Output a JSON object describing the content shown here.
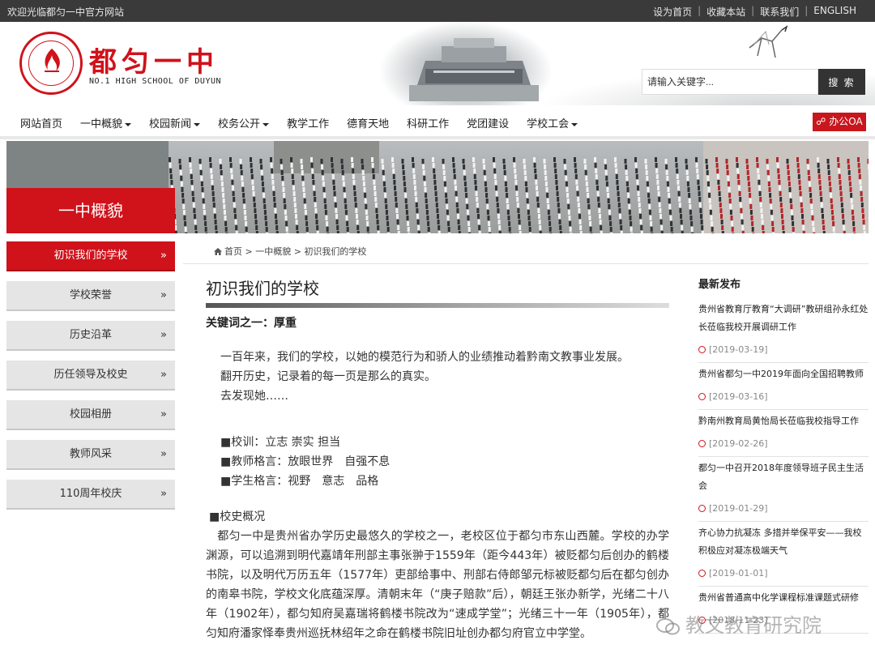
{
  "topbar": {
    "welcome": "欢迎光临都匀一中官方网站",
    "links": [
      "设为首页",
      "收藏本站",
      "联系我们",
      "ENGLISH"
    ]
  },
  "header": {
    "school_cn": "都匀一中",
    "school_en": "NO.1 HIGH SCHOOL OF DUYUN",
    "search_placeholder": "请输入关键字...",
    "search_button": "搜 索"
  },
  "nav": {
    "items": [
      {
        "label": "网站首页",
        "dropdown": false
      },
      {
        "label": "一中概貌",
        "dropdown": true
      },
      {
        "label": "校园新闻",
        "dropdown": true
      },
      {
        "label": "校务公开",
        "dropdown": true
      },
      {
        "label": "教学工作",
        "dropdown": false
      },
      {
        "label": "德育天地",
        "dropdown": false
      },
      {
        "label": "科研工作",
        "dropdown": false
      },
      {
        "label": "党团建设",
        "dropdown": false
      },
      {
        "label": "学校工会",
        "dropdown": true
      }
    ],
    "oa_label": "办公OA"
  },
  "banner": {
    "title": "一中概貌"
  },
  "sidebar": {
    "arrow": "»",
    "items": [
      {
        "label": "初识我们的学校",
        "active": true
      },
      {
        "label": "学校荣誉",
        "active": false
      },
      {
        "label": "历史沿革",
        "active": false
      },
      {
        "label": "历任领导及校史",
        "active": false
      },
      {
        "label": "校园相册",
        "active": false
      },
      {
        "label": "教师风采",
        "active": false
      },
      {
        "label": "110周年校庆",
        "active": false
      }
    ]
  },
  "breadcrumb": [
    "首页",
    "一中概貌",
    "初识我们的学校"
  ],
  "breadcrumb_sep": ">",
  "article": {
    "title": "初识我们的学校",
    "keyword": "关键词之一：厚重",
    "intro": [
      "一百年来，我们的学校，以她的模范行为和骄人的业绩推动着黔南文教事业发展。",
      "翻开历史，记录着的每一页是那么的真实。",
      "去发现她……"
    ],
    "mottos": [
      "■校训：立志 崇实 担当",
      "■教师格言：放眼世界　自强不息",
      "■学生格言：视野　意志　品格"
    ],
    "history_heading": "■校史概况",
    "history_text": "　都匀一中是贵州省办学历史最悠久的学校之一，老校区位于都匀市东山西麓。学校的办学渊源，可以追溯到明代嘉靖年刑部主事张翀于1559年（距今443年）被贬都匀后创办的鹤楼书院，以及明代万历五年（1577年）吏部给事中、刑部右侍郎邹元标被贬都匀后在都匀创办的南皋书院，学校文化底蕴深厚。清朝末年（“庚子赔款”后），朝廷王张办新学，光绪二十八年（1902年），都匀知府吴嘉瑞将鹤楼书院改为“速成学堂”；光绪三十一年（1905年），都匀知府潘家怿奉贵州巡抚林绍年之命在鹤楼书院旧址创办都匀府官立中学堂。"
  },
  "latest": {
    "title": "最新发布",
    "items": [
      {
        "title": "贵州省教育厅教育“大调研”教研组孙永红处长莅临我校开展调研工作",
        "date": "[2019-03-19]"
      },
      {
        "title": "贵州省都匀一中2019年面向全国招聘教师",
        "date": "[2019-03-16]"
      },
      {
        "title": "黔南州教育局黄怡局长莅临我校指导工作",
        "date": "[2019-02-26]"
      },
      {
        "title": "都匀一中召开2018年度领导班子民主生活会",
        "date": "[2019-01-29]"
      },
      {
        "title": "齐心协力抗凝冻 多措并举保平安——我校积极应对凝冻极端天气",
        "date": "[2019-01-01]"
      },
      {
        "title": "贵州省普通高中化学课程标准课题式研修",
        "date": "[2018-11-23]"
      }
    ]
  },
  "watermark": "教文教育研究院"
}
